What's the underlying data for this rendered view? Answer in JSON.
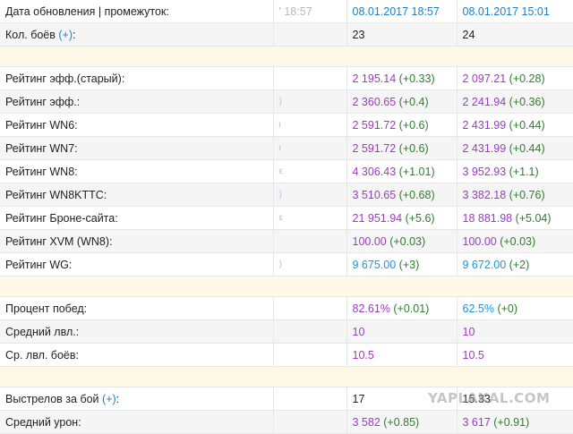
{
  "header": {
    "label": "Дата обновления | промежуток:",
    "col2": "' 18:57",
    "col3": "08.01.2017 18:57",
    "col4": "08.01.2017 15:01"
  },
  "battles": {
    "label": "Кол. боёв",
    "plus": "(+)",
    "suffix": ":",
    "col3": "23",
    "col4": "24"
  },
  "ratings": [
    {
      "label": "Рейтинг эфф.(старый):",
      "col2": "",
      "col3": "2 195.14",
      "d3": "(+0.33)",
      "col4": "2 097.21",
      "d4": "(+0.28)",
      "color3": "purple",
      "color4": "purple"
    },
    {
      "label": "Рейтинг эфф.:",
      "col2": ")",
      "col3": "2 360.65",
      "d3": "(+0.4)",
      "col4": "2 241.94",
      "d4": "(+0.36)",
      "color3": "purple",
      "color4": "purple"
    },
    {
      "label": "Рейтинг WN6:",
      "col2": "ι",
      "col3": "2 591.72",
      "d3": "(+0.6)",
      "col4": "2 431.99",
      "d4": "(+0.44)",
      "color3": "purple",
      "color4": "purple"
    },
    {
      "label": "Рейтинг WN7:",
      "col2": "ι",
      "col3": "2 591.72",
      "d3": "(+0.6)",
      "col4": "2 431.99",
      "d4": "(+0.44)",
      "color3": "purple",
      "color4": "purple"
    },
    {
      "label": "Рейтинг WN8:",
      "col2": "ε",
      "col3": "4 306.43",
      "d3": "(+1.01)",
      "col4": "3 952.93",
      "d4": "(+1.1)",
      "color3": "purple",
      "color4": "purple"
    },
    {
      "label": "Рейтинг WN8KTTC:",
      "col2": ")",
      "col3": "3 510.65",
      "d3": "(+0.68)",
      "col4": "3 382.18",
      "d4": "(+0.76)",
      "color3": "purple",
      "color4": "purple"
    },
    {
      "label": "Рейтинг Броне-сайта:",
      "col2": "ε",
      "col3": "21 951.94",
      "d3": "(+5.6)",
      "col4": "18 881.98",
      "d4": "(+5.04)",
      "color3": "purple",
      "color4": "purple"
    },
    {
      "label": "Рейтинг XVM (WN8):",
      "col2": "",
      "col3": "100.00",
      "d3": "(+0.03)",
      "col4": "100.00",
      "d4": "(+0.03)",
      "color3": "purple",
      "color4": "purple"
    },
    {
      "label": "Рейтинг WG:",
      "col2": ")",
      "col3": "9 675.00",
      "d3": "(+3)",
      "col4": "9 672.00",
      "d4": "(+2)",
      "color3": "blue",
      "color4": "blue"
    }
  ],
  "general": [
    {
      "label": "Процент побед:",
      "col3": "82.61%",
      "d3": "(+0.01)",
      "col4": "62.5%",
      "d4": "(+0)",
      "color3": "purple",
      "color4": "blue"
    },
    {
      "label": "Средний лвл.:",
      "col3": "10",
      "d3": "",
      "col4": "10",
      "d4": "",
      "color3": "purple",
      "color4": "purple"
    },
    {
      "label": "Ср. лвл. боёв:",
      "col3": "10.5",
      "d3": "",
      "col4": "10.5",
      "d4": "",
      "color3": "purple",
      "color4": "purple"
    }
  ],
  "shots": {
    "label": "Выстрелов за бой",
    "plus": "(+)",
    "suffix": ":",
    "col3": "17",
    "col4": "15.33"
  },
  "damage": {
    "label": "Средний урон:",
    "col3": "3 582",
    "d3": "(+0.85)",
    "col4": "3 617",
    "d4": "(+0.91)"
  },
  "watermark": "YAPLAKAL.COM",
  "colors": {
    "purple": "#9a3cc0",
    "blue": "#1d97d4",
    "green": "#2e7d2e",
    "link": "#1f7ec4",
    "separator": "#fdf9e6"
  }
}
